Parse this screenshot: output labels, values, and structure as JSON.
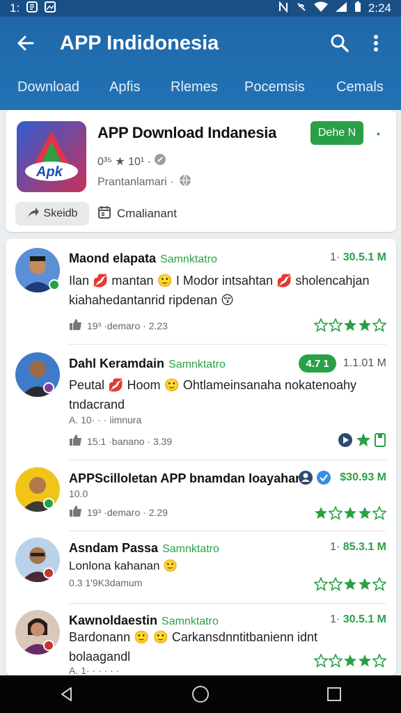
{
  "status_bar": {
    "left_text": "1:",
    "time": "2:24"
  },
  "app_bar": {
    "title": "APP Indidonesia"
  },
  "tabs": [
    "Download",
    "Apfis",
    "Rlemes",
    "Pocemsis",
    "Cemals"
  ],
  "app_card": {
    "name": "APP Download Indanesia",
    "install_label": "Dehe N",
    "rating_text": "0³⁵ ★ 10¹ ·",
    "publisher": "Prantanlamari ·",
    "share_label": "Skeidb",
    "calendar_label": "Cmalianant",
    "icon_text": "Apk",
    "icon_colors": [
      "#2f5fcf",
      "#c8305a",
      "#2aa046"
    ]
  },
  "reviews": [
    {
      "name": "Maond elapata",
      "tag": "Samnktatro",
      "meta_prefix": "1·",
      "meta_value": "30.5.1 M",
      "text": "Ilan 💋 mantan 🙂 I Modor intsahtan 💋 sholencahjan kiahahedantanrid ripdenan 😚",
      "footer": "19³ ·demaro · 2.23",
      "stars": 3
    },
    {
      "name": "Dahl Keramdain",
      "tag": "Samnktatro",
      "pill": "4.7 1",
      "meta_value": "1.1.01 M",
      "text": "Peutal 💋 Hoom 🙂 Ohtlameinsanaha nokatenoahy tndacrand",
      "sub": "A. 10· · · iimnura",
      "footer": "15:1 ·banano · 3.39",
      "stars": 2
    },
    {
      "name": "APPScilloletan APP bnamdan Ioayahan",
      "meta_value": "$30.93 M",
      "text": "10.0",
      "footer": "19³ ·demaro · 2.29",
      "stars": 3
    },
    {
      "name": "Asndam Passa",
      "tag": "Samnktatro",
      "meta_prefix": "1·",
      "meta_value": "85.3.1 M",
      "text": "Lonlona kahanan 🙂",
      "footer": "0.3 1'9K3damum",
      "stars": 3
    },
    {
      "name": "Kawnoldaestin",
      "tag": "Samnktatro",
      "meta_prefix": "1·",
      "meta_value": "30.5.1 M",
      "text": "Bardonann 🙂 🙂 Carkansdnntitbanienn idnt bolaagandl",
      "sub": "A. 1· · · · · ·",
      "stars": 3
    }
  ],
  "colors": {
    "primary": "#2272b5",
    "accent": "#2aa046",
    "background": "#eceff1"
  }
}
